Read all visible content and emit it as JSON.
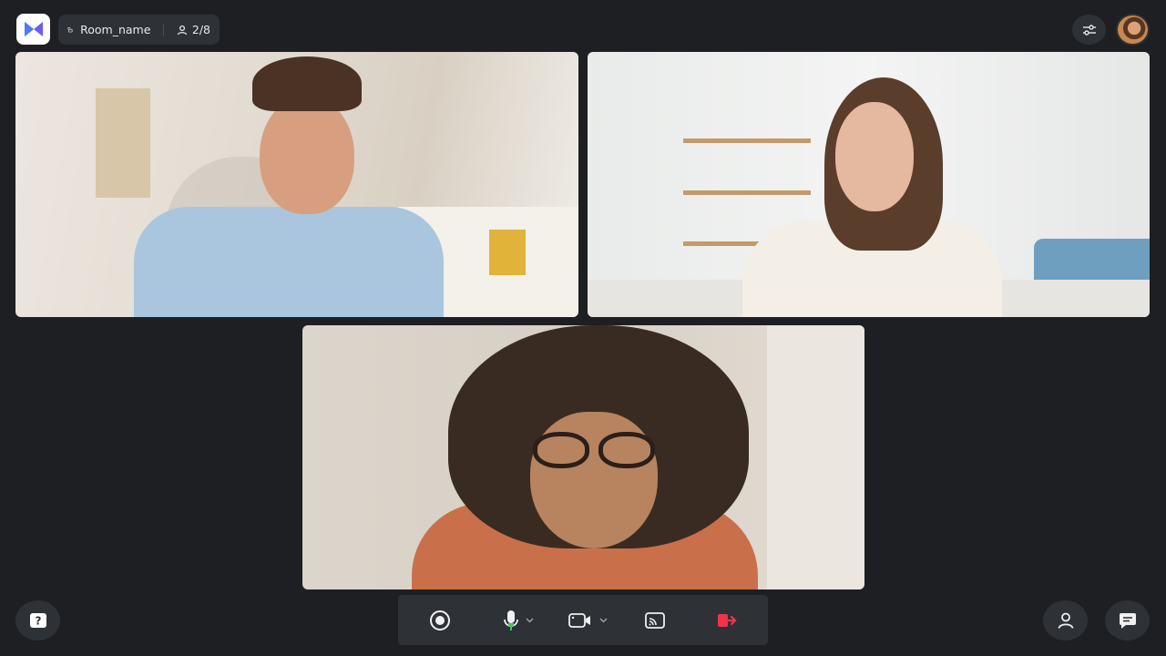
{
  "app": {
    "logo_icon": "app-logo-icon",
    "brand_color": "#6b5cf6"
  },
  "room": {
    "name": "Room_name",
    "lock_icon": "unlock-icon",
    "participants_icon": "person-icon",
    "participants_count": "2/8"
  },
  "top_actions": {
    "settings_icon": "sliders-icon",
    "avatar": "user-avatar"
  },
  "participants": [
    {
      "tile": "video-tile-1",
      "description_icon": "participant-video"
    },
    {
      "tile": "video-tile-2",
      "description_icon": "participant-video"
    },
    {
      "tile": "video-tile-3",
      "description_icon": "participant-video"
    }
  ],
  "bottom_controls": {
    "help_icon": "help-icon",
    "record_icon": "record-icon",
    "mic_icon": "microphone-icon",
    "camera_icon": "camera-icon",
    "cast_icon": "cast-icon",
    "leave_icon": "leave-icon",
    "people_icon": "people-icon",
    "chat_icon": "chat-icon",
    "mic_color": "#3ccf4e",
    "leave_color": "#f0334a"
  }
}
